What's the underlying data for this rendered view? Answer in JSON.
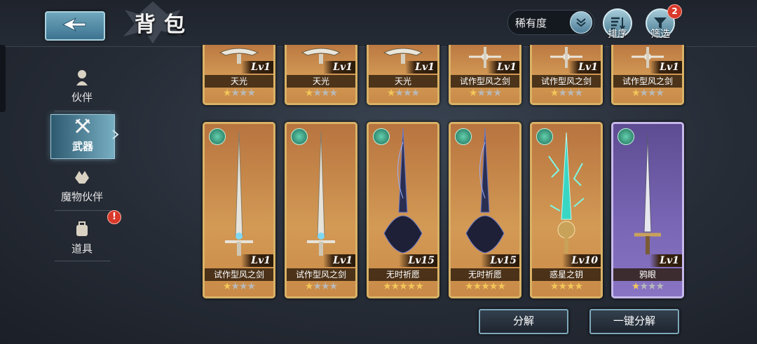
{
  "header": {
    "title": "背包",
    "rarity_filter": "稀有度",
    "sort_label": "排序",
    "filter_label": "筛选",
    "filter_badge": "2"
  },
  "sidebar": {
    "items": [
      {
        "label": "伙伴",
        "icon": "partner-icon",
        "active": false
      },
      {
        "label": "武器",
        "icon": "weapon-icon",
        "active": true
      },
      {
        "label": "魔物伙伴",
        "icon": "monster-icon",
        "active": false
      },
      {
        "label": "道具",
        "icon": "backpack-icon",
        "active": false
      }
    ],
    "items_alert": "!"
  },
  "weapons_top": [
    {
      "name": "天光",
      "level": "Lv1",
      "stars": 1
    },
    {
      "name": "天光",
      "level": "Lv1",
      "stars": 1
    },
    {
      "name": "天光",
      "level": "Lv1",
      "stars": 1
    },
    {
      "name": "试作型风之剑",
      "level": "Lv1",
      "stars": 1
    },
    {
      "name": "试作型风之剑",
      "level": "Lv1",
      "stars": 1
    },
    {
      "name": "试作型风之剑",
      "level": "Lv1",
      "stars": 1
    }
  ],
  "weapons_bottom": [
    {
      "name": "试作型风之剑",
      "level": "Lv1",
      "stars": 1,
      "frame": "gold"
    },
    {
      "name": "试作型风之剑",
      "level": "Lv1",
      "stars": 1,
      "frame": "gold"
    },
    {
      "name": "无时祈愿",
      "level": "Lv15",
      "stars": 5,
      "frame": "gold"
    },
    {
      "name": "无时祈愿",
      "level": "Lv15",
      "stars": 5,
      "frame": "gold"
    },
    {
      "name": "惑星之钥",
      "level": "Lv10",
      "stars": 4,
      "frame": "gold"
    },
    {
      "name": "鸦眼",
      "level": "Lv1",
      "stars": 1,
      "frame": "purple"
    }
  ],
  "actions": {
    "decompose": "分解",
    "one_click_decompose": "一键分解"
  },
  "colors": {
    "gold_frame": "#d9b266",
    "purple_frame": "#c6b8ea",
    "accent": "#77aec2",
    "badge_red": "#d8392b"
  }
}
